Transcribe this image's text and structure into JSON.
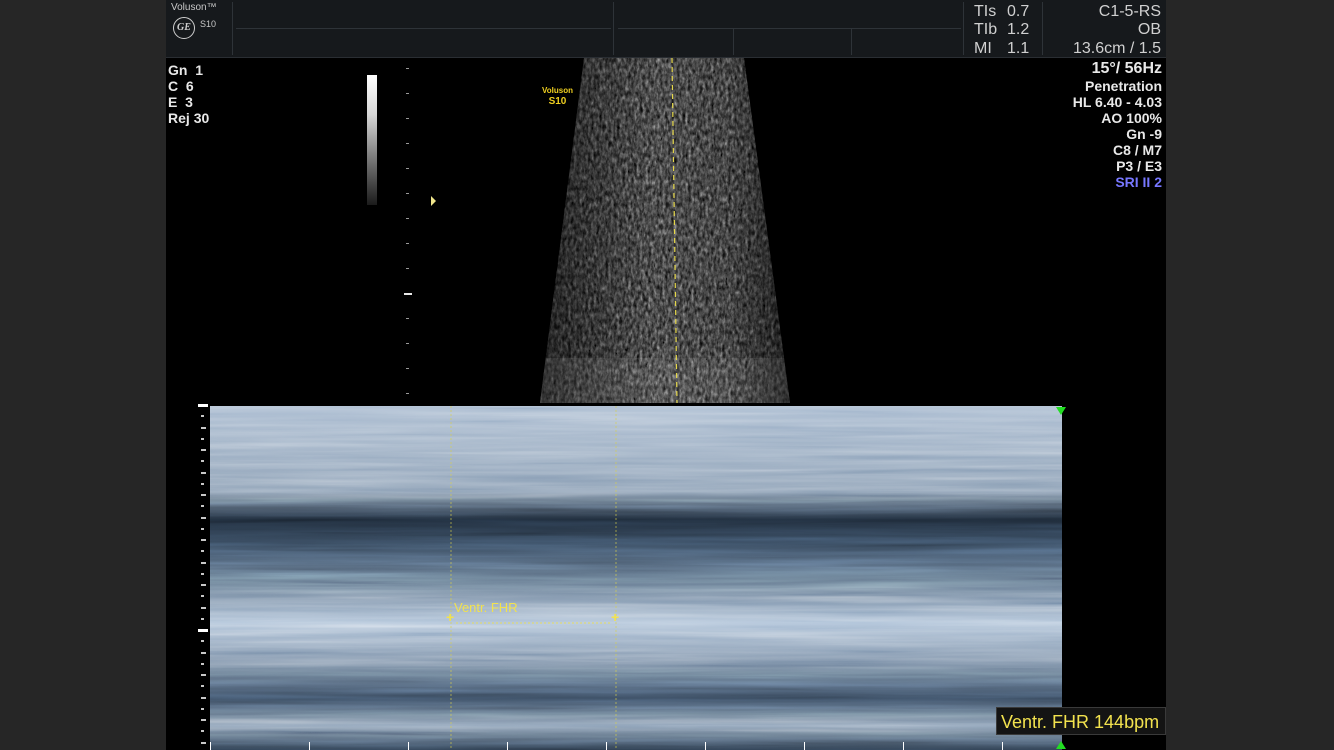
{
  "brand": {
    "name": "Voluson™",
    "model": "S10",
    "logo": "GE"
  },
  "header": {
    "tis": {
      "label": "TIs",
      "value": "0.7"
    },
    "tib": {
      "label": "TIb",
      "value": "1.2"
    },
    "mi": {
      "label": "MI",
      "value": "1.1"
    },
    "probe": "C1-5-RS",
    "preset": "OB",
    "depth_info": "13.6cm / 1.5"
  },
  "left_params": {
    "gn": {
      "label": "Gn",
      "value": "1"
    },
    "c": {
      "label": "C",
      "value": "6"
    },
    "e": {
      "label": "E",
      "value": "3"
    },
    "rej": {
      "label": "Rej",
      "value": "30"
    }
  },
  "right_params": {
    "angle_freq": "15°/ 56Hz",
    "mode": "Penetration",
    "hl": "HL  6.40 - 4.03",
    "ao": "AO 100%",
    "gn": "Gn  -9",
    "cm": "C8 / M7",
    "pe": "P3 / E3",
    "sri": "SRI II 2"
  },
  "image_watermark": {
    "line1": "Voluson",
    "line2": "S10"
  },
  "measurement": {
    "label": "Ventr. FHR",
    "result": "Ventr. FHR 144bpm"
  },
  "colors": {
    "text": "#e8e8e8",
    "caliper": "#f2e24e",
    "sri": "#7777ff",
    "marker": "#22dd22"
  },
  "icons": [
    "ge-logo-icon",
    "focus-marker-icon",
    "caliper-cross-icon",
    "green-triangle-icon"
  ]
}
